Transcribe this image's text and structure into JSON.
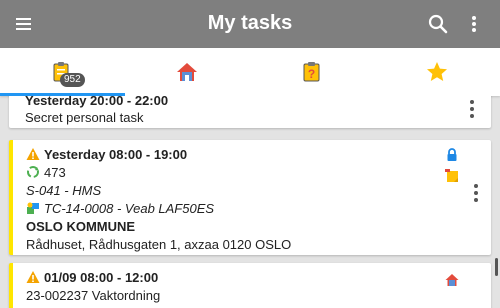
{
  "appbar": {
    "title": "My tasks",
    "menu_icon": "menu-icon",
    "search_icon": "search-icon",
    "more_icon": "more-vert-icon",
    "background": "#7f7f7f"
  },
  "tabs": [
    {
      "icon": "clipboard-tasks-icon",
      "badge": "952",
      "active": true
    },
    {
      "icon": "home-icon",
      "active": false
    },
    {
      "icon": "clipboard-question-icon",
      "active": false
    },
    {
      "icon": "star-icon",
      "active": false
    }
  ],
  "tasks": [
    {
      "time": "Yesterday 20:00 - 22:00",
      "title": "Secret personal task"
    },
    {
      "time": "Yesterday 08:00 - 19:00",
      "number": "473",
      "code": "S-041 - HMS",
      "ticket": "TC-14-0008 - Veab LAF50ES",
      "customer": "OSLO KOMMUNE",
      "address": "Rådhuset, Rådhusgaten 1, axzaa 0120 OSLO"
    },
    {
      "time": "01/09 08:00 - 12:00",
      "order": "23-002237 Vaktordning"
    }
  ],
  "colors": {
    "accent": "#2196f3",
    "warning_bar": "#ffe600",
    "star": "#ffc107"
  }
}
